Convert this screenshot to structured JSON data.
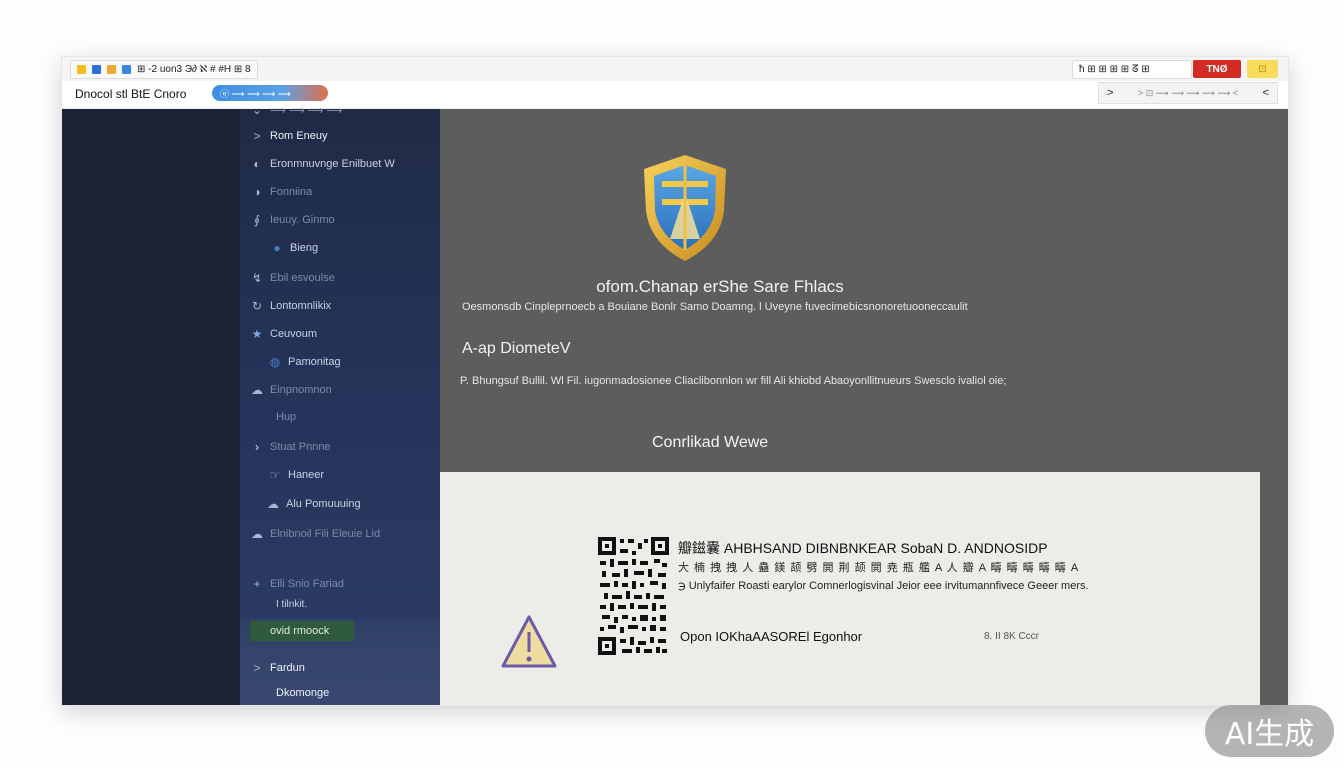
{
  "toolbar": {
    "left_items": [
      "M",
      "⊞ -2",
      "uon3",
      "tЭ∂",
      "ℵ",
      "#",
      "⊞",
      "ħ",
      "⟫"
    ],
    "left_label": "⊞ -2 uon3 Э∂ ℵ # #H ⊞ 8",
    "right_label": "ħ ⊞ ⊞ ⊞ ⊞ ᘔ ⊞",
    "red_button": "TNØ",
    "yellow_button": "⊡",
    "accent_red": "#d12b24",
    "accent_yellow": "#f7dc5c"
  },
  "addressbar": {
    "site_name": "Dnocol stl BtE Cnoro",
    "url": "ⓞ ⟶ ⟶ ⟶ ⟶",
    "right_text": "> ⊡ ⟿ ⟿ ⟿ ⟿ ⟿ <"
  },
  "sidebar": {
    "items": [
      {
        "icon": "chevron-down-icon",
        "label": "⟶ ⟶ ⟶ ⟶"
      },
      {
        "icon": "chevron-right-icon",
        "label": "Rom Eneuy"
      },
      {
        "icon": "globe-icon",
        "label": "Eronmnuvnge Enilbuet W"
      },
      {
        "icon": "headset-icon",
        "label": "Fonniina"
      },
      {
        "icon": "link-icon",
        "label": "Ieuuy. Ginmo"
      },
      {
        "icon": "world-icon",
        "label": "Bieng"
      },
      {
        "icon": "arrow-icon",
        "label": "Ebil esvoulse"
      },
      {
        "icon": "refresh-icon",
        "label": "Lontomnlikix"
      },
      {
        "icon": "star-icon",
        "label": "Ceuvoum"
      },
      {
        "icon": "globe-icon",
        "label": "Pamonitag"
      },
      {
        "icon": "cloud-icon",
        "label": "Einpnomnon"
      },
      {
        "icon": "",
        "label": "Hup"
      },
      {
        "icon": "chevron-right-icon",
        "label": "Stuat Pnnne"
      },
      {
        "icon": "hand-icon",
        "label": "Haneer"
      },
      {
        "icon": "cloud-icon",
        "label": "Alu Pomuuuing"
      },
      {
        "icon": "cloud-icon",
        "label": "Elnibnoil Fili Eleuie Lid"
      },
      {
        "icon": "plus-icon",
        "label": "Elli Snio Fariad"
      },
      {
        "icon": "",
        "label": "I tilnkit."
      },
      {
        "icon": "chevron-right-icon",
        "label": "Fardun"
      },
      {
        "icon": "",
        "label": "Dkomonge"
      }
    ],
    "active_item": "ovid rmoock"
  },
  "content": {
    "title": "ofom.Chanap erShe Sare Fhlacs",
    "description": "Oesmonsdb Cinpleprnoecb  a Bouiane Bonlr Samo Doamng. l Uveyne fuvecimebicsnonoretuooneccaulit",
    "subtitle": "A-ap DiometeV",
    "line": "P. Bhungsuf  Bullil. Wl Fil. iugonmadosionee Cliaclibonnlon wr fill Ali khiobd  Abaoyonllitnueurs Swesclo ivaliol oie;",
    "mid_label": "Conrlikad Wewe"
  },
  "panel": {
    "title": "瓣鎡囊 AHBHSAND DIBNBNKEAR  SobaN D.  ANDNOSIDP",
    "line2": "大 楠 拽 拽 人 蠱 鎂 颉 劈 閧 荆 颉 閧 尭 瓶 艦 A 人 瓣 A 疇 疇 疇 疇 疇 A",
    "line3": "℈ Unlyfaifer Roasti earylor Comnerlogisvinal Jeior eee irvitumannfivece  Geeer mers.",
    "action": "Opon IOKhaAASOREl Egonhor",
    "date": "8. II  8K Cccr"
  }
}
